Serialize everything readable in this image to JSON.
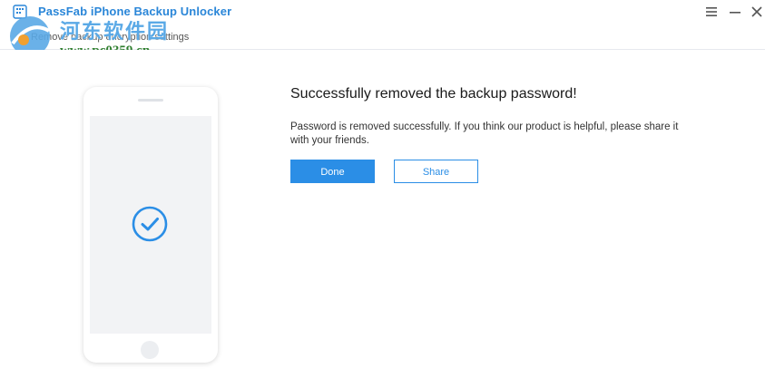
{
  "app": {
    "title": "PassFab iPhone Backup Unlocker",
    "accent": "#2b8ee6"
  },
  "window": {
    "icons": [
      "menu-icon",
      "minimize-icon",
      "close-icon"
    ]
  },
  "subbar": {
    "breadcrumb": "Remove backup encryption settings"
  },
  "watermark": {
    "name": "河东软件园",
    "url": "www.pc0359.cn"
  },
  "result": {
    "headline": "Successfully removed the backup password!",
    "message": "Password is removed successfully. If you think our product is helpful, please share it with your friends.",
    "done_label": "Done",
    "share_label": "Share",
    "icon": "check-circle-icon"
  }
}
